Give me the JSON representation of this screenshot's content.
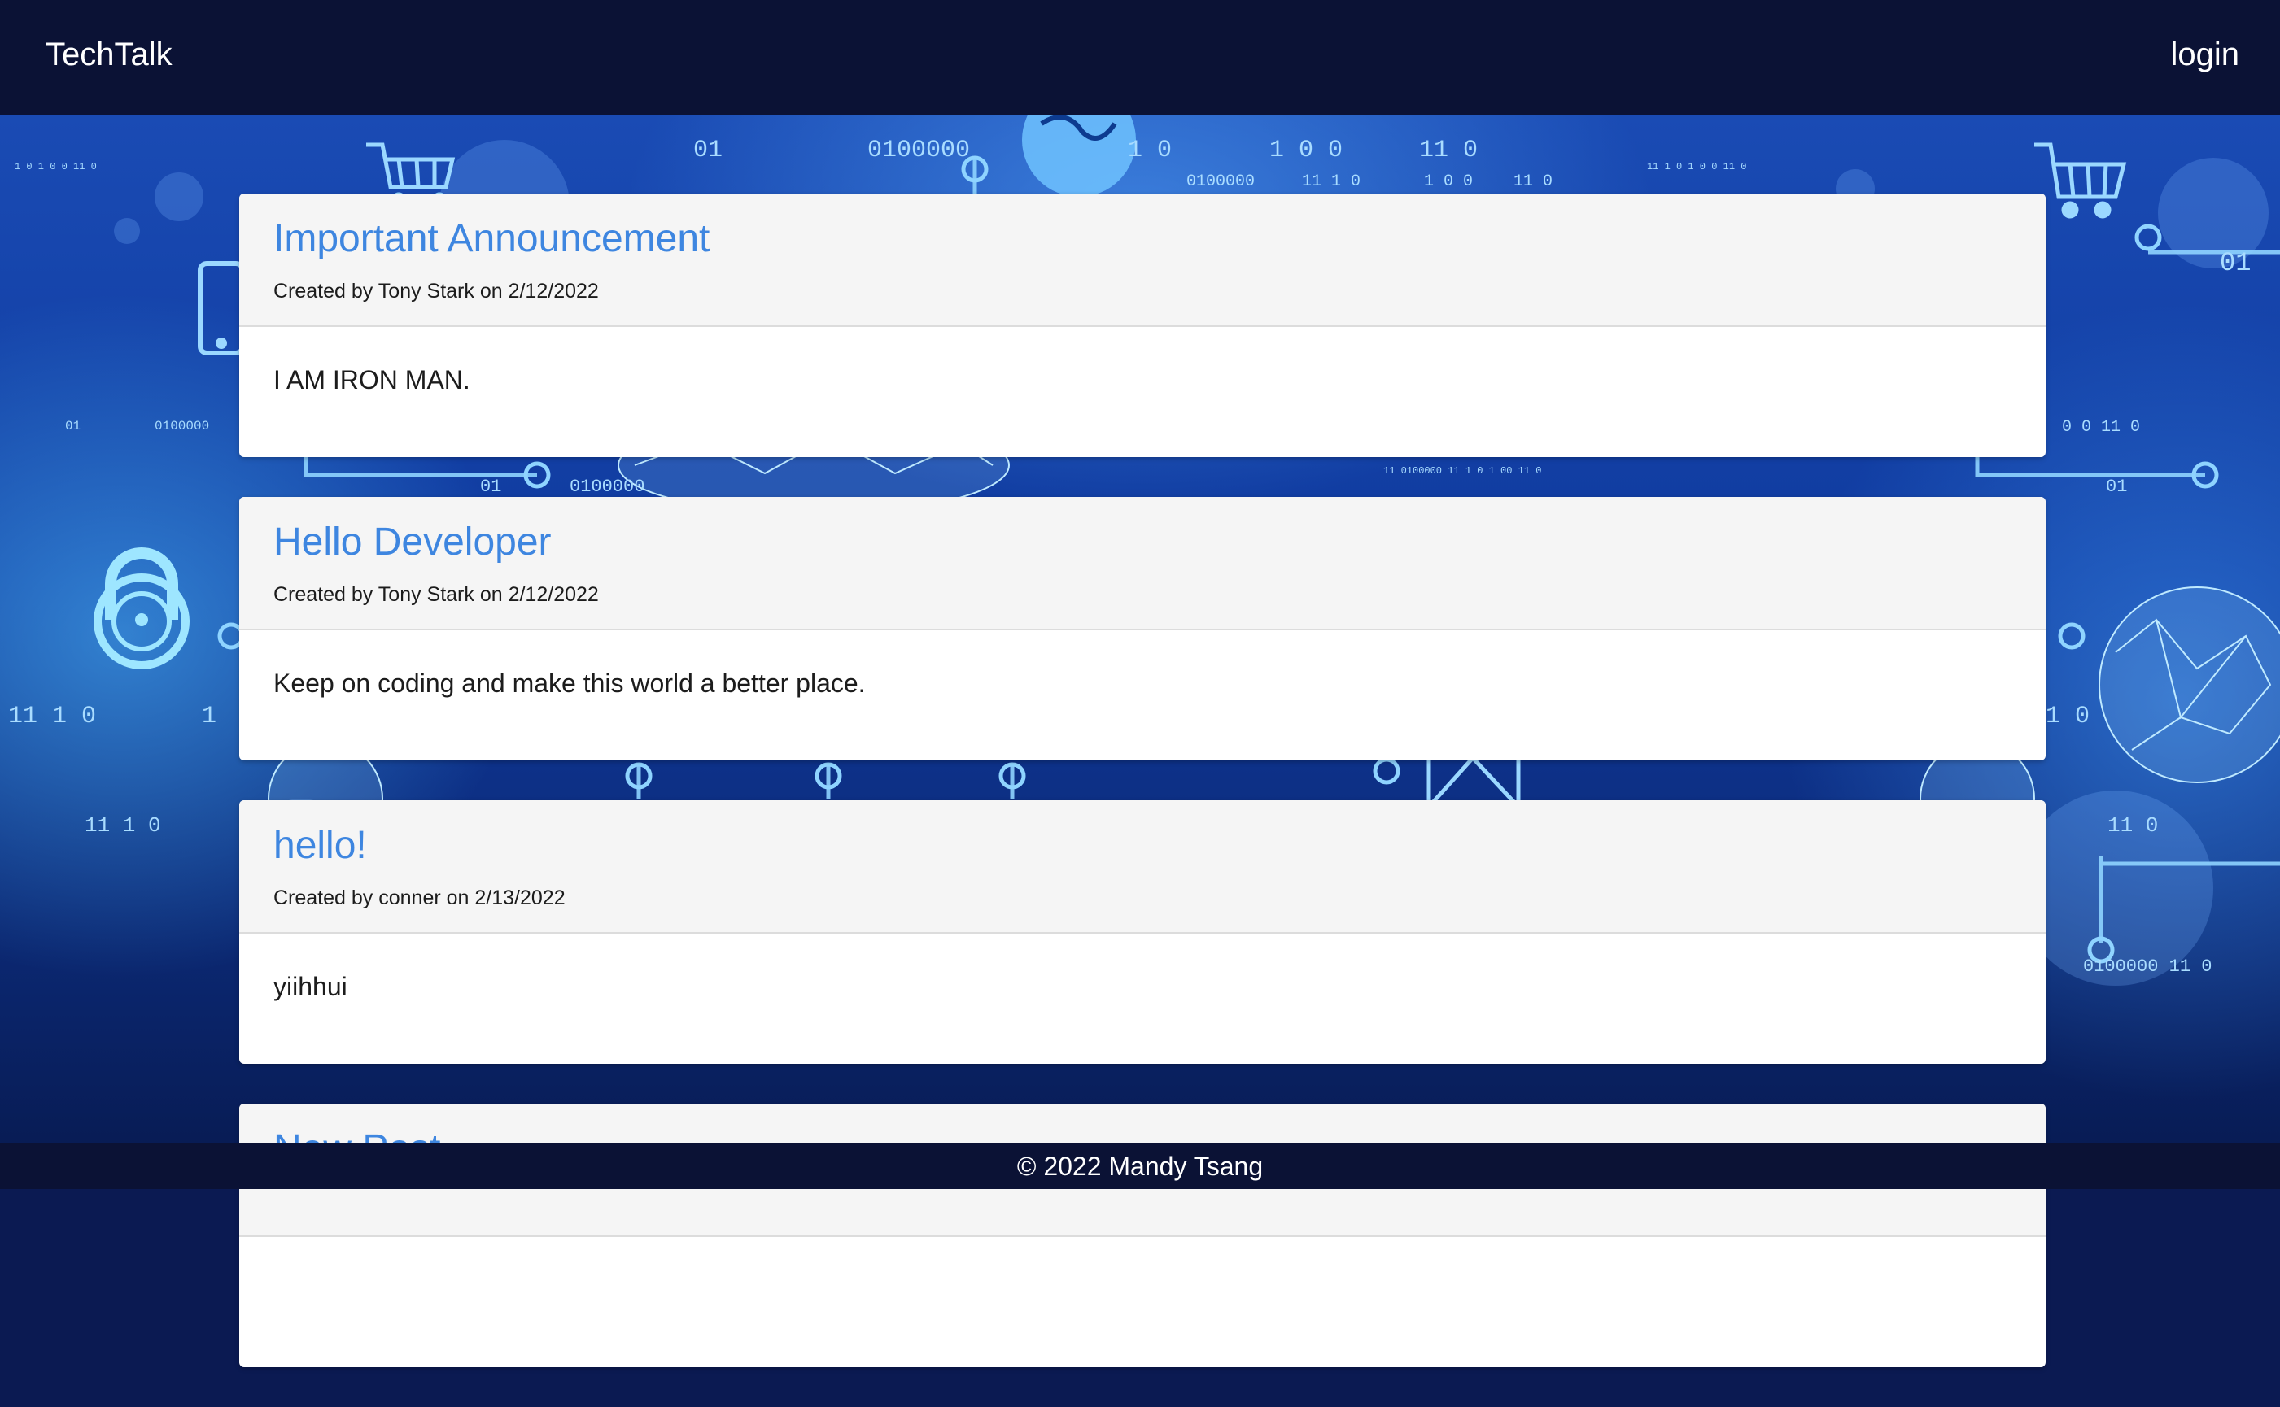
{
  "header": {
    "brand": "TechTalk",
    "login_label": "login"
  },
  "posts": [
    {
      "title": "Important Announcement",
      "meta": "Created by Tony Stark on 2/12/2022",
      "body": "I AM IRON MAN."
    },
    {
      "title": "Hello Developer",
      "meta": "Created by Tony Stark on 2/12/2022",
      "body": "Keep on coding and make this world a better place."
    },
    {
      "title": "hello!",
      "meta": "Created by conner on 2/13/2022",
      "body": "yiihhui"
    },
    {
      "title": "New Post",
      "meta": "",
      "body": ""
    }
  ],
  "footer": {
    "copyright": "© 2022 Mandy Tsang"
  },
  "colors": {
    "navbar": "#0b1235",
    "title_link": "#3e86e0",
    "card_header": "#f5f5f5",
    "background": "#1a4bb4"
  },
  "background_decor": {
    "binary_strings": [
      "01",
      "0100000",
      "1 0",
      "1 0 0",
      "11 0",
      "0100000",
      "11 1 0",
      "1 0 0",
      "11 0",
      "01",
      "0 0 11 0",
      "01",
      "11 1 0",
      "1 0",
      "01000",
      "11 0",
      "1 0",
      "11 1 0",
      "1 0 0 11 0"
    ],
    "icons": [
      "shopping-cart-icon",
      "globe-icon",
      "phone-icon",
      "padlock-icon",
      "envelope-icon",
      "network-sphere-icon"
    ]
  }
}
